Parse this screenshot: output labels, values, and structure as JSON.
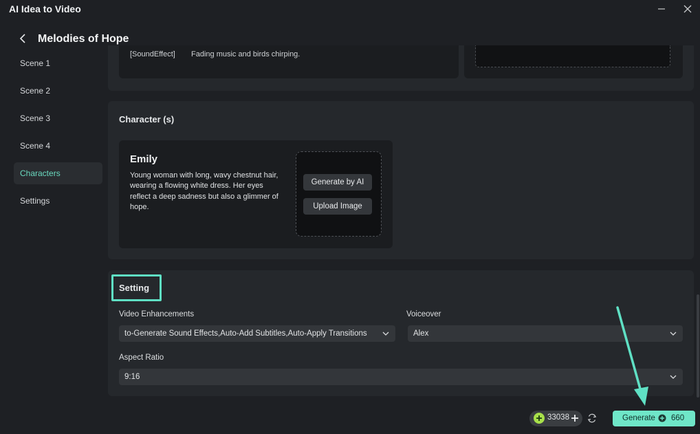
{
  "window": {
    "title": "AI Idea to Video"
  },
  "header": {
    "title": "Melodies of Hope"
  },
  "sidebar": {
    "items": [
      {
        "label": "Scene 1"
      },
      {
        "label": "Scene 2"
      },
      {
        "label": "Scene 3"
      },
      {
        "label": "Scene 4"
      },
      {
        "label": "Characters",
        "active": true
      },
      {
        "label": "Settings"
      }
    ]
  },
  "scene_partial": {
    "tag": "[SoundEffect]",
    "text": "Fading music and birds chirping."
  },
  "characters": {
    "title": "Character (s)",
    "items": [
      {
        "name": "Emily",
        "description": "Young woman with long, wavy chestnut hair, wearing a flowing white dress. Her eyes reflect a deep sadness but also a glimmer of hope.",
        "generate_label": "Generate by AI",
        "upload_label": "Upload Image"
      }
    ]
  },
  "setting": {
    "title": "Setting",
    "video_enhancements": {
      "label": "Video Enhancements",
      "value": "to-Generate Sound Effects,Auto-Add Subtitles,Auto-Apply Transitions"
    },
    "voiceover": {
      "label": "Voiceover",
      "value": "Alex"
    },
    "aspect_ratio": {
      "label": "Aspect Ratio",
      "value": "9:16"
    }
  },
  "footer": {
    "credits": "33038",
    "generate_label": "Generate",
    "generate_cost": "660"
  },
  "colors": {
    "accent": "#6fe6c8",
    "highlight": "#5fe0c4",
    "background": "#1e2024",
    "card": "#25282c"
  },
  "icons": [
    "minimize-icon",
    "close-icon",
    "back-arrow-icon",
    "chevron-down-icon",
    "credit-coin-icon",
    "plus-icon",
    "refresh-icon"
  ]
}
